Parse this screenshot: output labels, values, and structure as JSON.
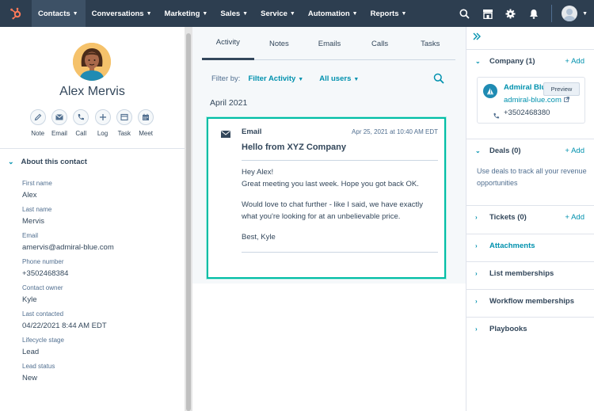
{
  "nav": {
    "items": [
      {
        "label": "Contacts",
        "active": true
      },
      {
        "label": "Conversations"
      },
      {
        "label": "Marketing"
      },
      {
        "label": "Sales"
      },
      {
        "label": "Service"
      },
      {
        "label": "Automation"
      },
      {
        "label": "Reports"
      }
    ],
    "icons": [
      "search-icon",
      "marketplace-icon",
      "settings-icon",
      "notifications-icon"
    ],
    "brand_color": "#ff7a59",
    "bg_color": "#2d3e50"
  },
  "contact": {
    "name": "Alex Mervis",
    "actions": [
      "Note",
      "Email",
      "Call",
      "Log",
      "Task",
      "Meet"
    ],
    "about_title": "About this contact",
    "fields": [
      {
        "label": "First name",
        "value": "Alex"
      },
      {
        "label": "Last name",
        "value": "Mervis"
      },
      {
        "label": "Email",
        "value": "amervis@admiral-blue.com"
      },
      {
        "label": "Phone number",
        "value": "+3502468384"
      },
      {
        "label": "Contact owner",
        "value": "Kyle"
      },
      {
        "label": "Last contacted",
        "value": "04/22/2021 8:44 AM EDT"
      },
      {
        "label": "Lifecycle stage",
        "value": "Lead"
      },
      {
        "label": "Lead status",
        "value": "New"
      }
    ]
  },
  "timeline": {
    "tabs": [
      "Activity",
      "Notes",
      "Emails",
      "Calls",
      "Tasks"
    ],
    "active_tab": "Activity",
    "filter_label": "Filter by:",
    "filter_activity": "Filter Activity",
    "filter_users": "All users",
    "month": "April 2021",
    "email": {
      "type": "Email",
      "date": "Apr 25, 2021 at 10:40 AM EDT",
      "subject": "Hello from XYZ Company",
      "greeting": "Hey Alex!",
      "line1": "Great meeting you last week. Hope you got back OK.",
      "para2": "Would love to chat further - like I said, we have exactly what you're looking for at an unbelievable price.",
      "signoff": "Best, Kyle"
    },
    "accent": "#00bda5"
  },
  "sidebar": {
    "company": {
      "title": "Company (1)",
      "add": "+ Add",
      "name": "Admiral Blue",
      "domain": "admiral-blue.com",
      "phone": "+3502468380",
      "preview": "Preview"
    },
    "deals": {
      "title": "Deals (0)",
      "add": "+ Add",
      "desc": "Use deals to track all your revenue opportunities"
    },
    "tickets": {
      "title": "Tickets (0)",
      "add": "+ Add"
    },
    "attachments": "Attachments",
    "list_memberships": "List memberships",
    "workflow_memberships": "Workflow memberships",
    "playbooks": "Playbooks"
  }
}
